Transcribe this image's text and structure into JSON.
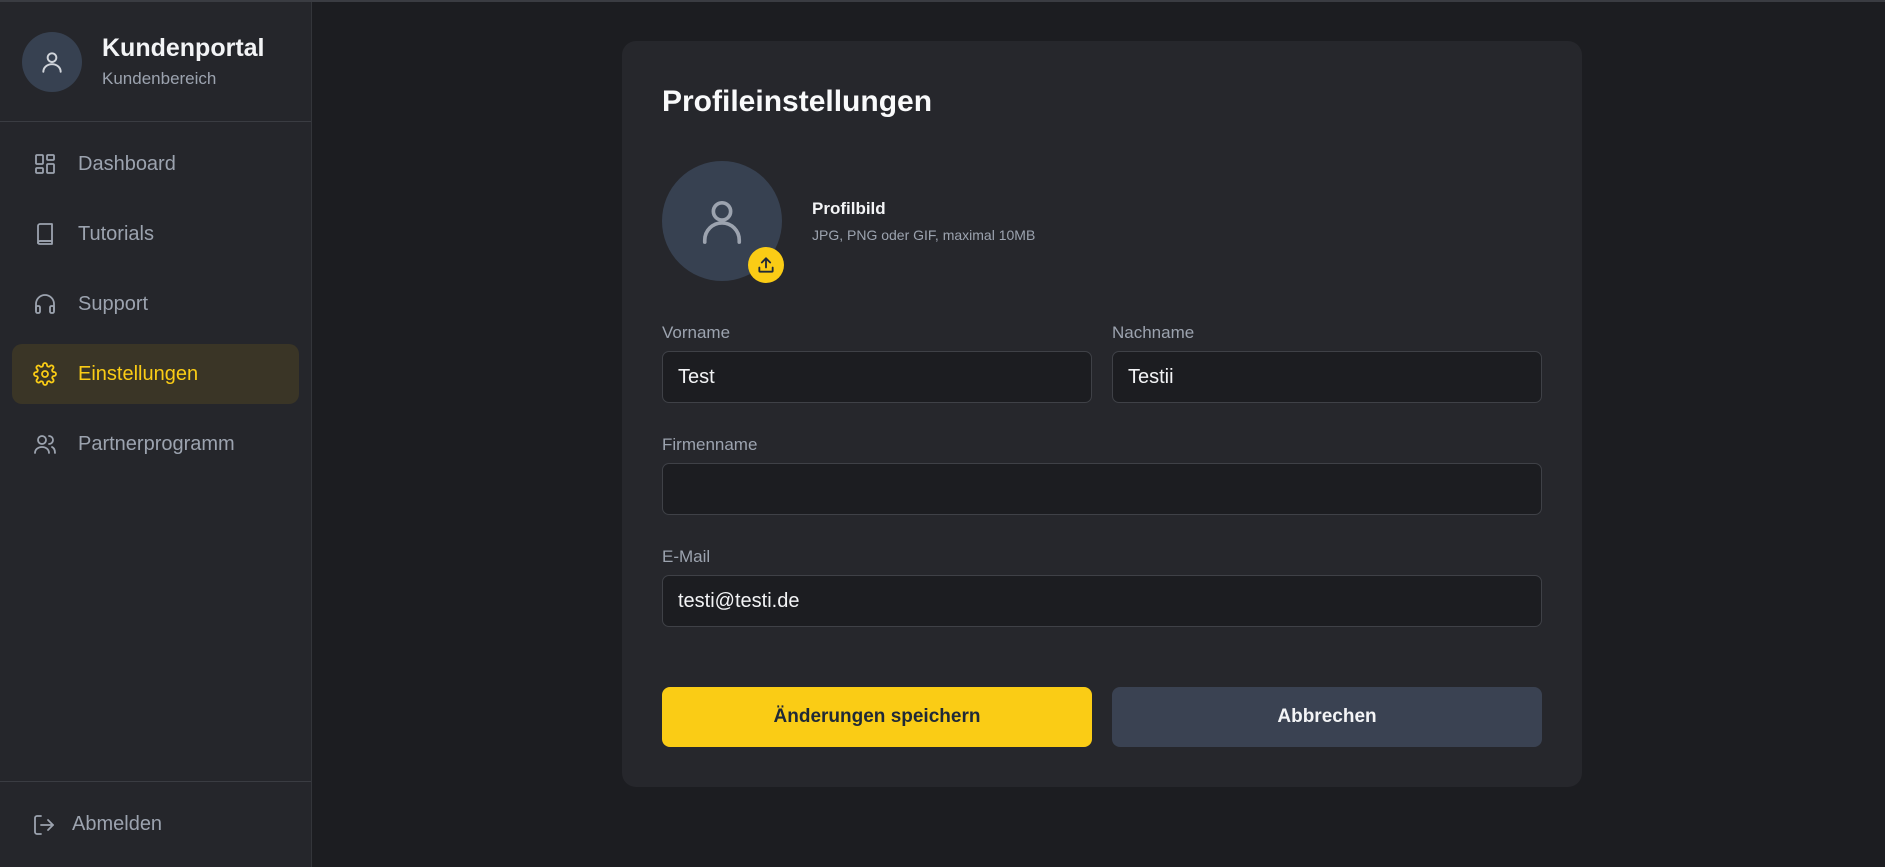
{
  "brand": {
    "title": "Kundenportal",
    "subtitle": "Kundenbereich",
    "avatar_icon": "user-icon"
  },
  "sidebar": {
    "items": [
      {
        "label": "Dashboard",
        "icon": "grid-icon",
        "active": false
      },
      {
        "label": "Tutorials",
        "icon": "book-icon",
        "active": false
      },
      {
        "label": "Support",
        "icon": "headphones-icon",
        "active": false
      },
      {
        "label": "Einstellungen",
        "icon": "gear-icon",
        "active": true
      },
      {
        "label": "Partnerprogramm",
        "icon": "users-icon",
        "active": false
      }
    ],
    "logout_label": "Abmelden"
  },
  "profile": {
    "title": "Profileinstellungen",
    "picture_label": "Profilbild",
    "picture_hint": "JPG, PNG oder GIF, maximal 10MB",
    "fields": {
      "first_name_label": "Vorname",
      "first_name_value": "Test",
      "last_name_label": "Nachname",
      "last_name_value": "Testii",
      "company_label": "Firmenname",
      "company_value": "",
      "email_label": "E-Mail",
      "email_value": "testi@testi.de"
    },
    "save_label": "Änderungen speichern",
    "cancel_label": "Abbrechen"
  },
  "colors": {
    "accent": "#facc15",
    "background": "#1c1d21",
    "card": "#26272c",
    "sidebar": "#25262b"
  }
}
